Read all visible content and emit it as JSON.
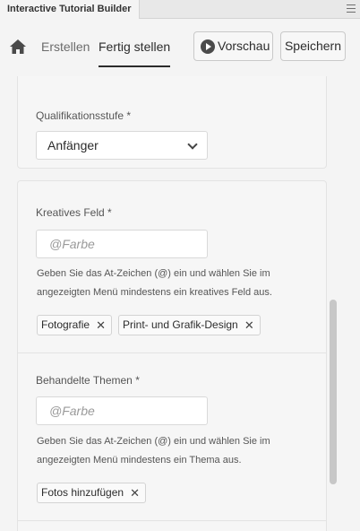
{
  "panel": {
    "title": "Interactive Tutorial Builder",
    "menu_icon": "hamburger-menu-icon"
  },
  "toolbar": {
    "home_icon": "home-icon",
    "tabs": [
      {
        "label": "Erstellen"
      },
      {
        "label": "Fertig stellen",
        "active": true
      }
    ],
    "preview_label": "Vorschau",
    "preview_icon": "play-circle-icon",
    "save_label": "Speichern"
  },
  "qualification": {
    "label": "Qualifikationsstufe *",
    "value": "Anfänger"
  },
  "creative_field": {
    "label": "Kreatives Feld *",
    "placeholder": "@Farbe",
    "help_line1": "Geben Sie das At-Zeichen (@) ein und wählen Sie im",
    "help_line2": "angezeigten Menü mindestens ein kreatives Feld aus.",
    "tags": [
      "Fotografie",
      "Print- und Grafik-Design"
    ]
  },
  "topics": {
    "label": "Behandelte Themen *",
    "placeholder": "@Farbe",
    "help_line1": "Geben Sie das At-Zeichen (@) ein und wählen Sie im",
    "help_line2": "angezeigten Menü mindestens ein Thema aus.",
    "tags": [
      "Fotos hinzufügen"
    ]
  },
  "tag_remove_glyph": "✕",
  "colors": {
    "accent": "#2c2c2c",
    "panel_bg": "#f4f4f4",
    "card_bg": "#f6f6f6"
  }
}
